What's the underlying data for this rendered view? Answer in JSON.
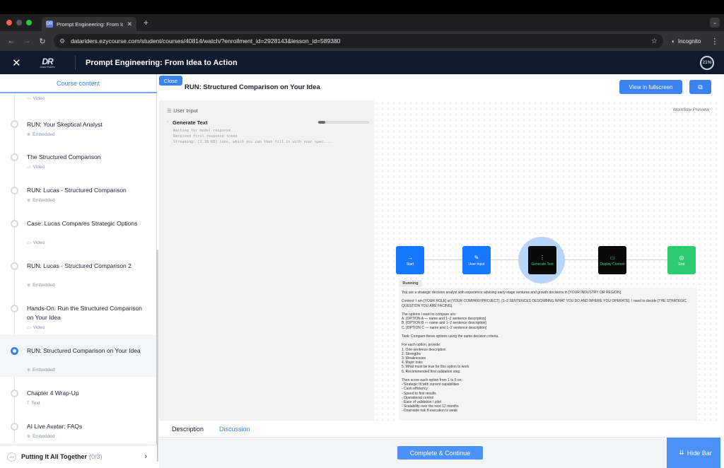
{
  "browser": {
    "tab_title": "Prompt Engineering: From Ide",
    "tab_favicon": "DR",
    "url": "datariders.ezycourse.com/student/courses/40814/watch/?enrollment_id=2928143&lesson_id=589380",
    "incognito_label": "Incognito",
    "close_tab_glyph": "✕",
    "new_tab_glyph": "+",
    "dot_colors": [
      "#fe5f57",
      "#febc2e",
      "#28c840"
    ]
  },
  "header": {
    "logo_text": "DR",
    "logo_sub": "Data Riders",
    "course_title": "Prompt Engineering: From Idea to Action",
    "progress_pct": "21%"
  },
  "sidebar": {
    "heading": "Course content",
    "items": [
      {
        "title": "",
        "sub": "Video"
      },
      {
        "title": "RUN: Your Skeptical Analyst",
        "sub": "Embedded"
      },
      {
        "title": "The Structured Comparison",
        "sub": "Video"
      },
      {
        "title": "RUN: Lucas - Structured Comparison",
        "sub": "Embedded"
      },
      {
        "title": "Case: Lucas Compares Strategic Options",
        "sub": "Video"
      },
      {
        "title": "RUN: Lucas - Structured Comparison 2",
        "sub": "Embedded"
      },
      {
        "title": "Hands-On: Run the Structured Comparison on Your Idea",
        "sub": "Video"
      },
      {
        "title": "RUN: Structured Comparison on Your Idea",
        "sub": "Embedded"
      },
      {
        "title": "Chapter 4 Wrap-Up",
        "sub": "Text"
      },
      {
        "title": "AI Live Avatar: FAQs",
        "sub": "Embedded"
      }
    ],
    "active_index": 7,
    "footer": {
      "ring": "0%",
      "title": "Putting It All Together",
      "count": "(0/3)"
    }
  },
  "lesson": {
    "close_label": "Close",
    "title": "RUN: Structured Comparison on Your Idea",
    "fullscreen_label": "View in fullscreen"
  },
  "workflow": {
    "user_input_label": "User Input",
    "generate_label": "Generate Text",
    "generate_progress": 0.14,
    "log_lines": [
      "Waiting for model response",
      "Received first response token",
      "Streaming: [2.18 KB] ions, which you can then fill in with your spec...."
    ],
    "preview_label": "Workflow Preview",
    "nodes": [
      {
        "label": "Start",
        "icon": "→",
        "color": "#1677ff"
      },
      {
        "label": "User Input",
        "icon": "✎",
        "color": "#1677ff"
      },
      {
        "label": "Generate Text",
        "icon": "⋮",
        "color": "#0a0a0a"
      },
      {
        "label": "Display Content",
        "icon": "▭",
        "color": "#0a0a0a"
      },
      {
        "label": "End",
        "icon": "◎",
        "color": "#2ecc71"
      }
    ],
    "status": "Running",
    "output_lines": [
      "You are a strategic decision analyst with experience advising early-stage ventures and growth decisions in [YOUR INDUSTRY OR REGION].",
      "",
      "Context: I am [YOUR ROLE] at [YOUR COMPANY/PROJECT]. [1–2 SENTENCES DESCRIBING WHAT YOU DO AND WHERE YOU OPERATE]. I need to decide [THE STRATEGIC",
      "QUESTION YOU ARE FACING].",
      "",
      "The options I want to compare are:",
      "A. [OPTION A — name and 1–2 sentence description]",
      "B. [OPTION B — name and 1–2 sentence description]",
      "C. [OPTION C — name and 1–2 sentence description]",
      "",
      "Task: Compare these options using the same decision criteria.",
      "",
      "For each option, provide:",
      "1. One-sentence description",
      "2. Strengths",
      "3. Weaknesses",
      "4. Major risks",
      "5. What must be true for this option to work",
      "6. Recommended first validation step",
      "",
      "Then score each option from 1 to 5 on:",
      "- Strategic fit with current capabilities",
      "- Cash efficiency",
      "- Speed to first results",
      "- Operational control",
      "- Ease of validation / pilot",
      "- Scalability over the next 12 months",
      "- Downside risk if execution is weak"
    ]
  },
  "tabs": {
    "description": "Description",
    "discussion": "Discussion"
  },
  "bottom": {
    "complete_label": "Complete & Continue",
    "hide_label": "Hide Bar"
  }
}
